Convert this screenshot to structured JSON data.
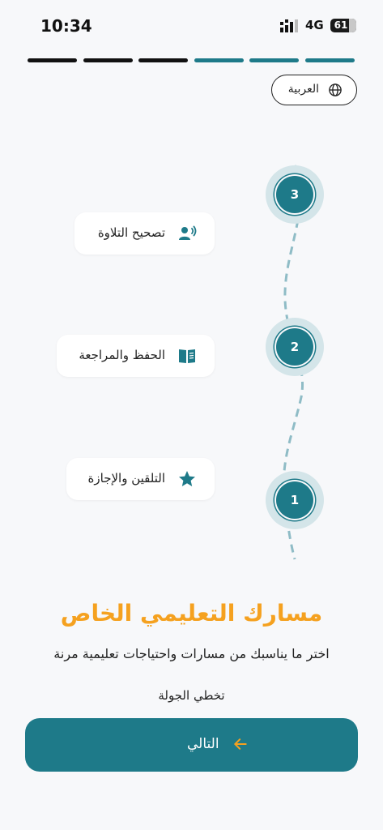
{
  "status_bar": {
    "time": "10:34",
    "network": "4G",
    "battery": "61"
  },
  "onboarding": {
    "total_steps": 6,
    "current_step": 4
  },
  "language_button": {
    "label": "العربية",
    "icon": "globe-icon"
  },
  "path_steps": [
    {
      "number": "3",
      "label": "تصحيح التلاوة",
      "icon": "user-voice-icon"
    },
    {
      "number": "2",
      "label": "الحفظ والمراجعة",
      "icon": "open-book-icon"
    },
    {
      "number": "1",
      "label": "التلقين والإجازة",
      "icon": "star-icon"
    }
  ],
  "main": {
    "title": "مسارك التعليمي الخاص",
    "subtitle": "اختر ما يناسبك من مسارات واحتياجات تعليمية مرنة",
    "skip_label": "تخطي الجولة",
    "next_label": "التالي"
  },
  "colors": {
    "primary": "#1e7a89",
    "accent": "#f5a11f",
    "completed_segment": "#111111",
    "path_dash": "#8fbcc6"
  }
}
